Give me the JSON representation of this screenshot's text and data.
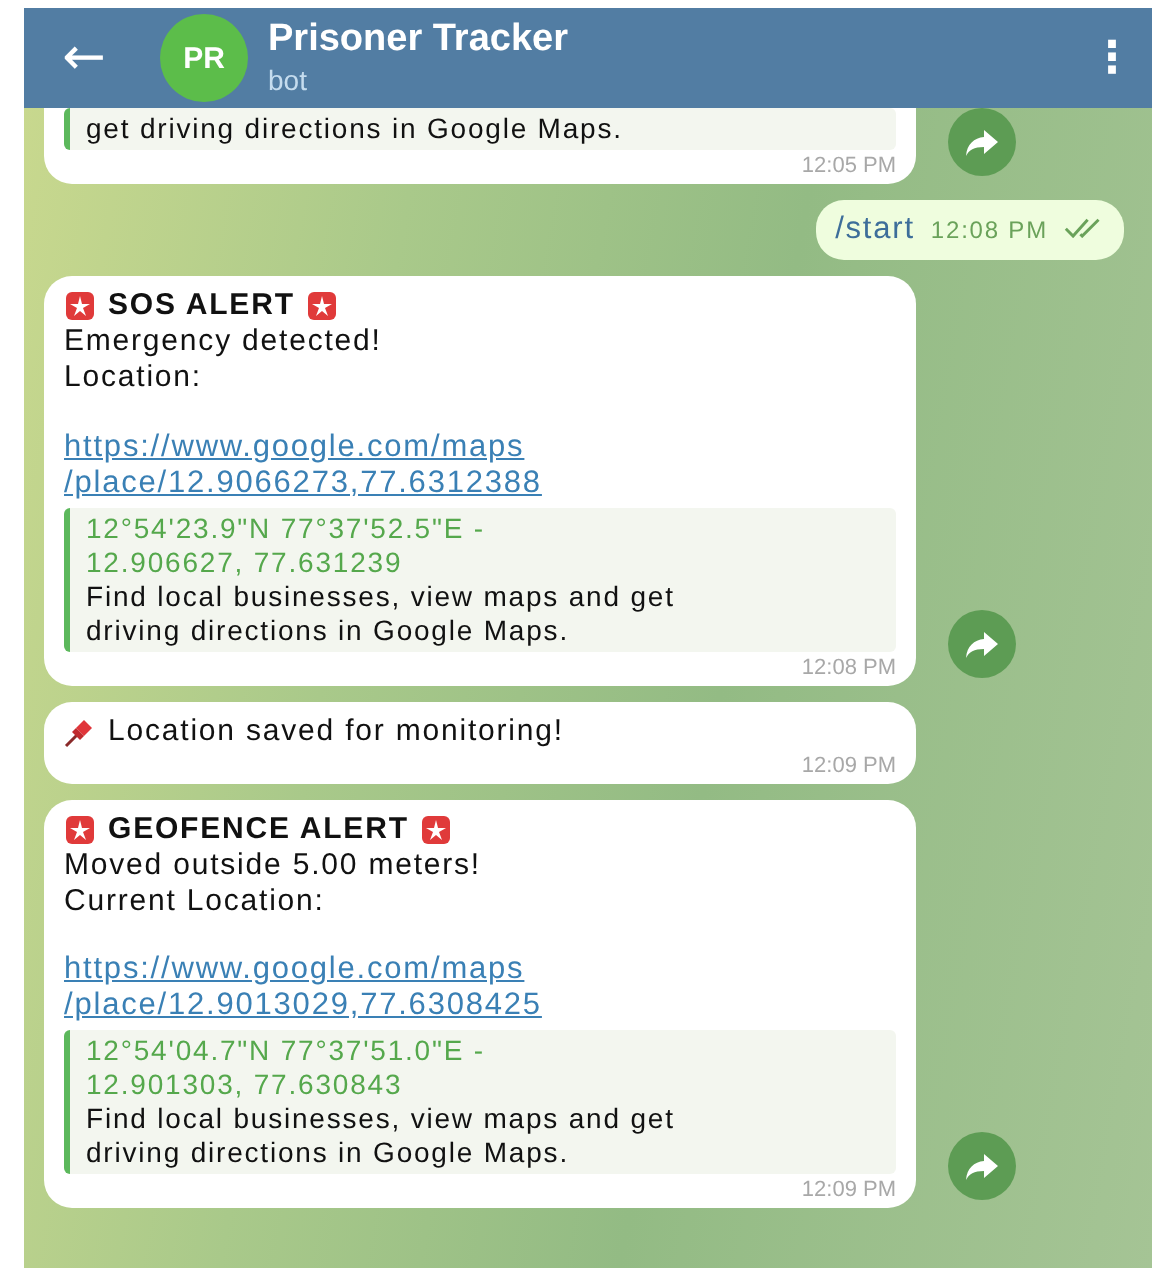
{
  "header": {
    "back": "←",
    "avatar": "PR",
    "title": "Prisoner Tracker",
    "subtitle": "bot",
    "menu": "⋮"
  },
  "messages": [
    {
      "kind": "incoming",
      "cut": true,
      "preview": {
        "description": "get driving directions in Google Maps."
      },
      "time": "12:05 PM",
      "forward": true
    },
    {
      "kind": "outgoing",
      "lines": [
        {
          "kind": "plain",
          "text": "/start"
        }
      ],
      "time": "12:08 PM",
      "read": true
    },
    {
      "kind": "incoming",
      "lines": [
        {
          "kind": "alert",
          "text": "SOS ALERT"
        },
        {
          "kind": "plain",
          "text": "Emergency detected!"
        },
        {
          "kind": "plain",
          "text": "Location:"
        }
      ],
      "link": [
        "https://www.google.com/maps",
        "/place/12.9066273,77.6312388"
      ],
      "preview": {
        "title": "12°54'23.9\"N 77°37'52.5\"E - 12.906627, 77.631239",
        "description": "Find local businesses, view maps and get driving directions in Google Maps."
      },
      "time": "12:08 PM",
      "forward": true
    },
    {
      "kind": "incoming",
      "lines": [
        {
          "kind": "pinned",
          "text": "Location saved for monitoring!"
        }
      ],
      "time": "12:09 PM",
      "forward": false
    },
    {
      "kind": "incoming",
      "lines": [
        {
          "kind": "alert",
          "text": "GEOFENCE ALERT"
        },
        {
          "kind": "plain",
          "text": "Moved outside 5.00 meters!"
        },
        {
          "kind": "plain",
          "text": "Current Location:"
        }
      ],
      "link": [
        "https://www.google.com/maps",
        "/place/12.9013029,77.6308425"
      ],
      "preview": {
        "title": "12°54'04.7\"N 77°37'51.0\"E - 12.901303, 77.630843",
        "description": "Find local businesses, view maps and get driving directions in Google Maps."
      },
      "time": "12:09 PM",
      "forward": true
    }
  ]
}
